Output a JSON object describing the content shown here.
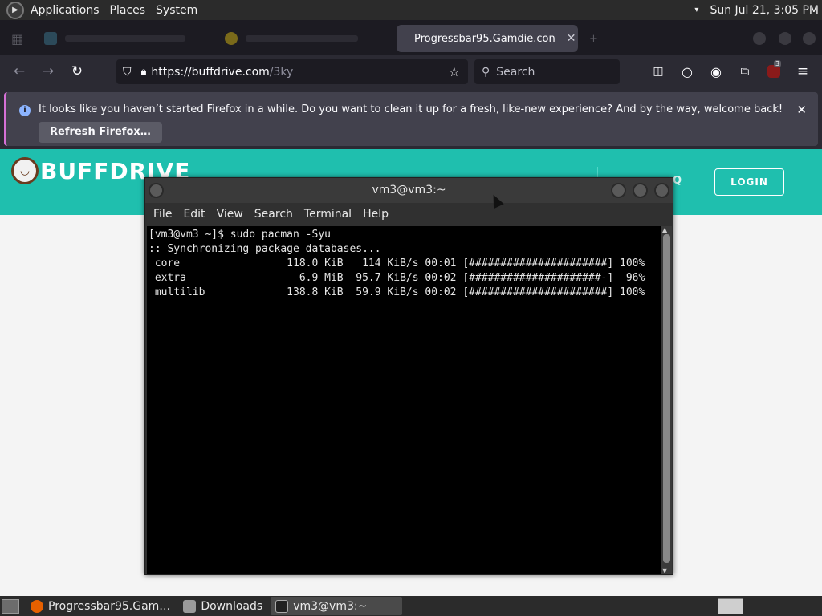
{
  "system_panel": {
    "menus": [
      "Applications",
      "Places",
      "System"
    ],
    "clock": "Sun Jul 21,  3:05 PM"
  },
  "browser": {
    "tabs": [
      {
        "label": "",
        "active": false
      },
      {
        "label": "",
        "active": false
      },
      {
        "label": "Progressbar95.Gamdie.con",
        "active": true
      }
    ],
    "url": "https://buffdrive.com/3ky",
    "url_host": "https://buffdrive.com",
    "url_path": "/3ky",
    "search_placeholder": "Search",
    "extension_badge": "3",
    "notification": {
      "message": "It looks like you haven’t started Firefox in a while. Do you want to clean it up for a fresh, like-new experience? And by the way, welcome back!",
      "button": "Refresh Firefox…"
    }
  },
  "website": {
    "logo_text": "BUFFDRIVE",
    "nav_partial": "Q",
    "login_label": "LOGIN",
    "header_color": "#1fbfae"
  },
  "terminal": {
    "title": "vm3@vm3:~",
    "menu": [
      "File",
      "Edit",
      "View",
      "Search",
      "Terminal",
      "Help"
    ],
    "lines": [
      "[vm3@vm3 ~]$ sudo pacman -Syu",
      ":: Synchronizing package databases...",
      " core                 118.0 KiB   114 KiB/s 00:01 [######################] 100%",
      " extra                  6.9 MiB  95.7 KiB/s 00:02 [#####################-]  96%",
      " multilib             138.8 KiB  59.9 KiB/s 00:02 [######################] 100%"
    ]
  },
  "taskbar": {
    "items": [
      {
        "label": "Progressbar95.Gam…",
        "active": false
      },
      {
        "label": "Downloads",
        "active": false
      },
      {
        "label": "vm3@vm3:~",
        "active": true
      }
    ]
  }
}
